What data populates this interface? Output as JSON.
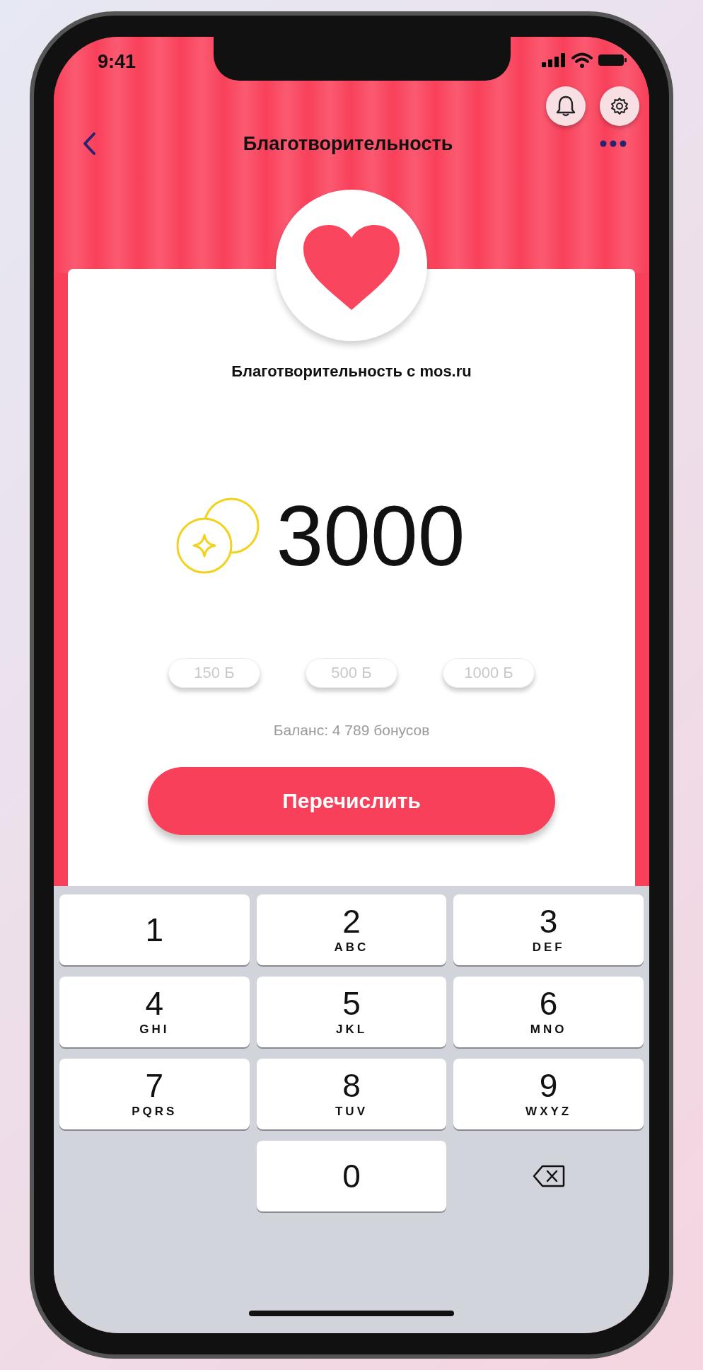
{
  "status_bar": {
    "time": "9:41"
  },
  "nav": {
    "title": "Благотворительность"
  },
  "card": {
    "subtitle": "Благотворительность с mos.ru",
    "amount": "3000",
    "presets": [
      {
        "label": "150 Б"
      },
      {
        "label": "500 Б"
      },
      {
        "label": "1000 Б"
      }
    ],
    "balance": "Баланс: 4 789 бонусов",
    "submit": "Перечислить"
  },
  "keyboard": [
    {
      "kind": "digit",
      "digit": "1"
    },
    {
      "kind": "digit",
      "digit": "2",
      "letters": "ABC"
    },
    {
      "kind": "digit",
      "digit": "3",
      "letters": "DEF"
    },
    {
      "kind": "digit",
      "digit": "4",
      "letters": "GHI"
    },
    {
      "kind": "digit",
      "digit": "5",
      "letters": "JKL"
    },
    {
      "kind": "digit",
      "digit": "6",
      "letters": "MNO"
    },
    {
      "kind": "digit",
      "digit": "7",
      "letters": "PQRS"
    },
    {
      "kind": "digit",
      "digit": "8",
      "letters": "TUV"
    },
    {
      "kind": "digit",
      "digit": "9",
      "letters": "WXYZ"
    },
    {
      "kind": "blank"
    },
    {
      "kind": "digit",
      "digit": "0"
    },
    {
      "kind": "delete"
    }
  ]
}
